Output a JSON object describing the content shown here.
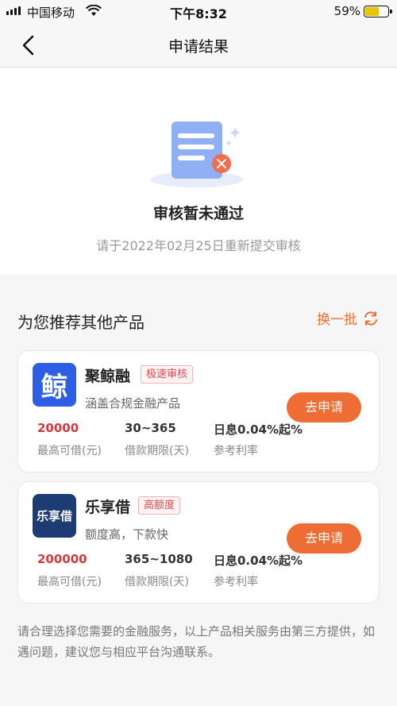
{
  "status": {
    "carrier": "中国移动",
    "time": "下午8:32",
    "battery": "59%"
  },
  "nav": {
    "title": "申请结果"
  },
  "result": {
    "title": "审核暂未通过",
    "subtitle": "请于2022年02月25日重新提交审核"
  },
  "recommend": {
    "title": "为您推荐其他产品",
    "refresh_label": "换一批"
  },
  "products": [
    {
      "logo_text": "鲸",
      "name": "聚鲸融",
      "tag": "极速审核",
      "desc": "涵盖合规金融产品",
      "apply": "去申请",
      "stats": [
        {
          "value": "20000",
          "label": "最高可借(元)"
        },
        {
          "value": "30~365",
          "label": "借款期限(天)"
        },
        {
          "value": "日息0.04%起%",
          "label": "参考利率"
        }
      ]
    },
    {
      "logo_text": "乐享借",
      "name": "乐享借",
      "tag": "高额度",
      "desc": "额度高，下款快",
      "apply": "去申请",
      "stats": [
        {
          "value": "200000",
          "label": "最高可借(元)"
        },
        {
          "value": "365~1080",
          "label": "借款期限(天)"
        },
        {
          "value": "日息0.04%起%",
          "label": "参考利率"
        }
      ]
    }
  ],
  "footer": {
    "text": "请合理选择您需要的金融服务，以上产品相关服务由第三方提供，如遇问题，建议您与相应平台沟通联系。"
  },
  "colors": {
    "accent": "#ed6d34",
    "tag_red": "#e3494f",
    "value_red": "#d8383c"
  }
}
